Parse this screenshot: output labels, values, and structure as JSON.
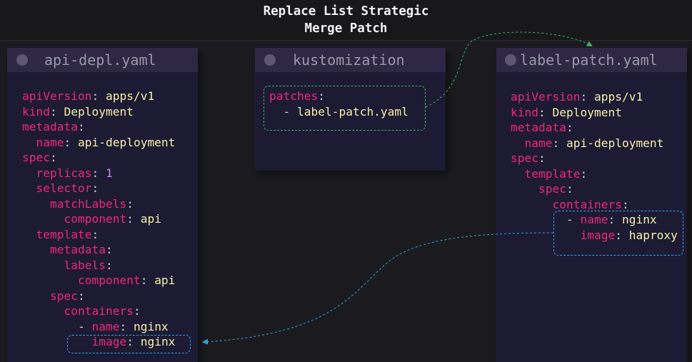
{
  "title": {
    "line1": "Replace List Strategic",
    "line2": "Merge Patch"
  },
  "panels": {
    "api_depl": {
      "header": "api-depl.yaml",
      "lines": [
        [
          [
            "k",
            "apiVersion"
          ],
          [
            "p",
            ": "
          ],
          [
            "v",
            "apps/v1"
          ]
        ],
        [
          [
            "k",
            "kind"
          ],
          [
            "p",
            ": "
          ],
          [
            "v",
            "Deployment"
          ]
        ],
        [
          [
            "k",
            "metadata"
          ],
          [
            "p",
            ":"
          ]
        ],
        [
          [
            "p",
            "  "
          ],
          [
            "k",
            "name"
          ],
          [
            "p",
            ": "
          ],
          [
            "v",
            "api-deployment"
          ]
        ],
        [
          [
            "k",
            "spec"
          ],
          [
            "p",
            ":"
          ]
        ],
        [
          [
            "p",
            "  "
          ],
          [
            "k",
            "replicas"
          ],
          [
            "p",
            ": "
          ],
          [
            "n",
            "1"
          ]
        ],
        [
          [
            "p",
            "  "
          ],
          [
            "k",
            "selector"
          ],
          [
            "p",
            ":"
          ]
        ],
        [
          [
            "p",
            "    "
          ],
          [
            "k",
            "matchLabels"
          ],
          [
            "p",
            ":"
          ]
        ],
        [
          [
            "p",
            "      "
          ],
          [
            "k",
            "component"
          ],
          [
            "p",
            ": "
          ],
          [
            "v",
            "api"
          ]
        ],
        [
          [
            "p",
            "  "
          ],
          [
            "k",
            "template"
          ],
          [
            "p",
            ":"
          ]
        ],
        [
          [
            "p",
            "    "
          ],
          [
            "k",
            "metadata"
          ],
          [
            "p",
            ":"
          ]
        ],
        [
          [
            "p",
            "      "
          ],
          [
            "k",
            "labels"
          ],
          [
            "p",
            ":"
          ]
        ],
        [
          [
            "p",
            "        "
          ],
          [
            "k",
            "component"
          ],
          [
            "p",
            ": "
          ],
          [
            "v",
            "api"
          ]
        ],
        [
          [
            "p",
            "    "
          ],
          [
            "k",
            "spec"
          ],
          [
            "p",
            ":"
          ]
        ],
        [
          [
            "p",
            "      "
          ],
          [
            "k",
            "containers"
          ],
          [
            "p",
            ":"
          ]
        ],
        [
          [
            "p",
            "        - "
          ],
          [
            "k",
            "name"
          ],
          [
            "p",
            ": "
          ],
          [
            "v",
            "nginx"
          ]
        ],
        [
          [
            "p",
            "          "
          ],
          [
            "k",
            "image"
          ],
          [
            "p",
            ": "
          ],
          [
            "v",
            "nginx"
          ]
        ]
      ]
    },
    "kustomization": {
      "header": "kustomization",
      "lines": [
        [
          [
            "k",
            "patches"
          ],
          [
            "p",
            ":"
          ]
        ],
        [
          [
            "p",
            "  - "
          ],
          [
            "v",
            "label-patch.yaml"
          ]
        ]
      ]
    },
    "label_patch": {
      "header": "label-patch.yaml",
      "lines": [
        [
          [
            "k",
            "apiVersion"
          ],
          [
            "p",
            ": "
          ],
          [
            "v",
            "apps/v1"
          ]
        ],
        [
          [
            "k",
            "kind"
          ],
          [
            "p",
            ": "
          ],
          [
            "v",
            "Deployment"
          ]
        ],
        [
          [
            "k",
            "metadata"
          ],
          [
            "p",
            ":"
          ]
        ],
        [
          [
            "p",
            "  "
          ],
          [
            "k",
            "name"
          ],
          [
            "p",
            ": "
          ],
          [
            "v",
            "api-deployment"
          ]
        ],
        [
          [
            "k",
            "spec"
          ],
          [
            "p",
            ":"
          ]
        ],
        [
          [
            "p",
            "  "
          ],
          [
            "k",
            "template"
          ],
          [
            "p",
            ":"
          ]
        ],
        [
          [
            "p",
            "    "
          ],
          [
            "k",
            "spec"
          ],
          [
            "p",
            ":"
          ]
        ],
        [
          [
            "p",
            "      "
          ],
          [
            "k",
            "containers"
          ],
          [
            "p",
            ":"
          ]
        ],
        [
          [
            "p",
            "        - "
          ],
          [
            "k",
            "name"
          ],
          [
            "p",
            ": "
          ],
          [
            "v",
            "nginx"
          ]
        ],
        [
          [
            "p",
            "          "
          ],
          [
            "k",
            "image"
          ],
          [
            "p",
            ": "
          ],
          [
            "v",
            "haproxy"
          ]
        ]
      ]
    }
  },
  "colors": {
    "key": "#f0287a",
    "value": "#f4f1a8",
    "number": "#c488f5",
    "green_highlight": "#3fb563",
    "blue_highlight": "#2ea3e6"
  }
}
